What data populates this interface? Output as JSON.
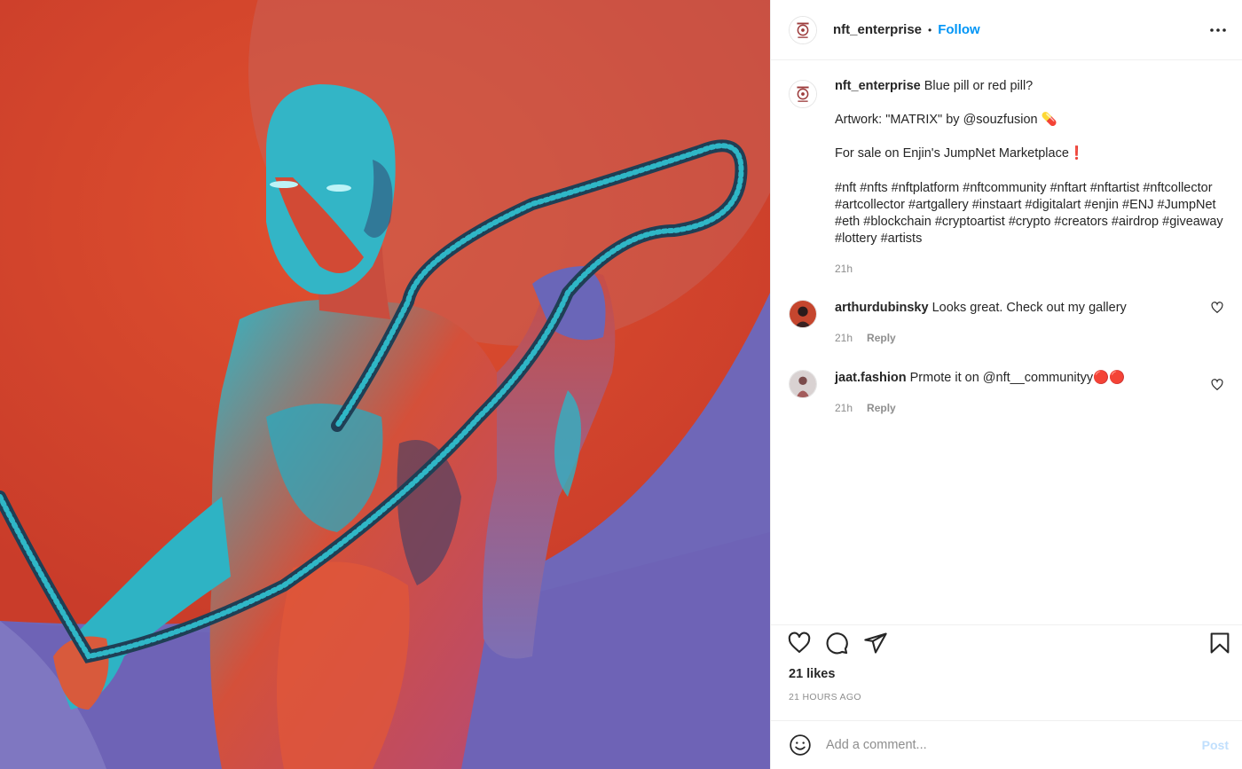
{
  "post": {
    "author": "nft_enterprise",
    "separator": "•",
    "follow_label": "Follow",
    "more_icon": "more-horizontal-icon"
  },
  "caption": {
    "user": "nft_enterprise",
    "line1": "Blue pill or red pill?",
    "line2": "Artwork: \"MATRIX\" by @souzfusion 💊",
    "line3": "For sale on Enjin's JumpNet Marketplace❗",
    "hashtags": "#nft #nfts #nftplatform #nftcommunity #nftart #nftartist #nftcollector #artcollector #artgallery #instaart #digitalart #enjin #ENJ #JumpNet #eth #blockchain #cryptoartist #crypto #creators #airdrop #giveaway #lottery #artists",
    "time": "21h"
  },
  "comments": [
    {
      "user": "arthurdubinsky",
      "text": "Looks great. Check out my gallery",
      "time": "21h",
      "reply": "Reply"
    },
    {
      "user": "jaat.fashion",
      "text": "Prmote it on @nft__communityy🔴🔴",
      "time": "21h",
      "reply": "Reply"
    }
  ],
  "actions": {
    "like_icon": "heart-icon",
    "comment_icon": "comment-icon",
    "share_icon": "send-icon",
    "save_icon": "bookmark-icon"
  },
  "likes": "21 likes",
  "time_ago": "21 HOURS AGO",
  "add_comment": {
    "placeholder": "Add a comment...",
    "post_label": "Post",
    "emoji_icon": "smiley-icon"
  },
  "colors": {
    "follow": "#0095f6",
    "post_disabled": "#c0dffd",
    "secondary_text": "#8e8e8e",
    "artwork_red": "#d9482e",
    "artwork_purple": "#6f67b8",
    "artwork_cyan": "#28b4c4"
  }
}
